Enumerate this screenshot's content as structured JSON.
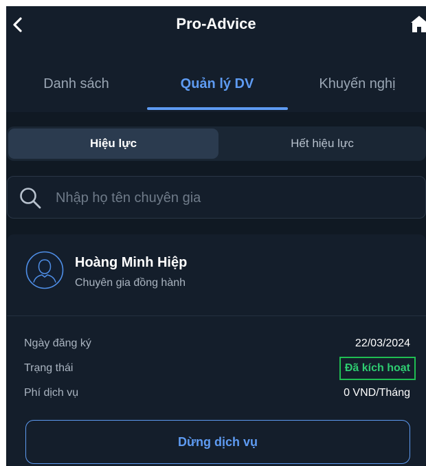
{
  "header": {
    "title": "Pro-Advice",
    "back_icon": "chevron-left-icon",
    "home_icon": "home-icon"
  },
  "tabs": [
    {
      "label": "Danh sách",
      "active": false
    },
    {
      "label": "Quản lý DV",
      "active": true
    },
    {
      "label": "Khuyến nghị",
      "active": false
    }
  ],
  "segment": {
    "active_label": "Hiệu lực",
    "inactive_label": "Hết hiệu lực"
  },
  "search": {
    "placeholder": "Nhập họ tên chuyên gia",
    "value": "",
    "icon": "search-icon"
  },
  "card": {
    "avatar_icon": "user-avatar-icon",
    "name": "Hoàng Minh Hiệp",
    "role": "Chuyên gia đồng hành",
    "rows": {
      "registration": {
        "label": "Ngày đăng ký",
        "value": "22/03/2024"
      },
      "status": {
        "label": "Trạng thái",
        "value": "Đã kích hoạt"
      },
      "fee": {
        "label": "Phí dịch vụ",
        "value": "0 VND/Tháng"
      }
    },
    "stop_button_label": "Dừng dịch vụ"
  },
  "colors": {
    "background": "#141e2b",
    "accent": "#5e9bf2",
    "status_active": "#2ecc71"
  }
}
